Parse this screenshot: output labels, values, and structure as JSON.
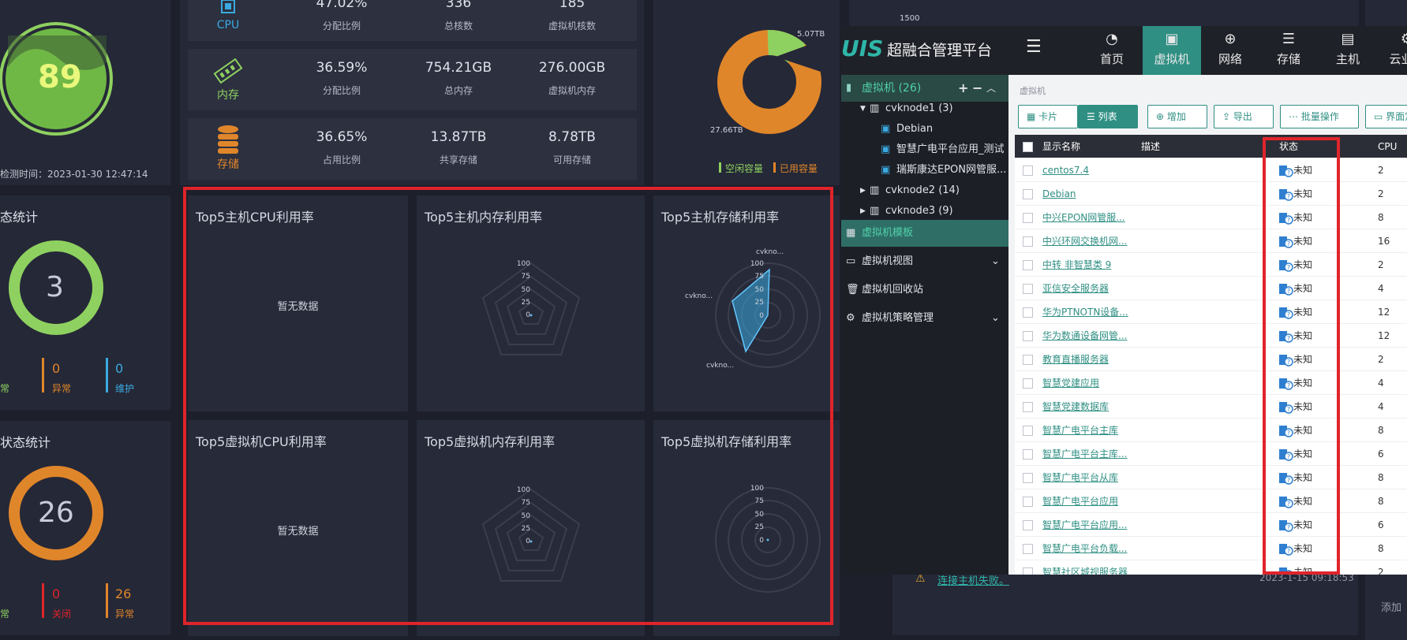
{
  "left": {
    "gauge_value": "89",
    "check_time": "检测时间：2023-01-30 12:47:14",
    "host_status": {
      "title": "态统计",
      "total": "3",
      "normal_label": "常",
      "abnormal_value": "0",
      "abnormal_label": "异常",
      "maint_value": "0",
      "maint_label": "维护"
    },
    "vm_status": {
      "title": "状态统计",
      "total": "26",
      "normal_label": "常",
      "off_value": "0",
      "off_label": "关闭",
      "abn_value": "26",
      "abn_label": "异常"
    }
  },
  "kpi": {
    "cpu": {
      "label": "CPU",
      "v1": "47.02%",
      "l1": "分配比例",
      "v2": "336",
      "l2": "总核数",
      "v3": "185",
      "l3": "虚拟机核数"
    },
    "mem": {
      "label": "内存",
      "v1": "36.59%",
      "l1": "分配比例",
      "v2": "754.21GB",
      "l2": "总内存",
      "v3": "276.00GB",
      "l3": "虚拟机内存"
    },
    "storage": {
      "label": "存储",
      "v1": "36.65%",
      "l1": "占用比例",
      "v2": "13.87TB",
      "l2": "共享存储",
      "v3": "8.78TB",
      "l3": "可用存储"
    }
  },
  "donut": {
    "top_label": "5.07TB",
    "left_label": "27.66TB",
    "legend_free": "空闲容量",
    "legend_used": "已用容量",
    "color_free": "#7cc35a",
    "color_used": "#e0862a"
  },
  "cards": {
    "host_cpu": "Top5主机CPU利用率",
    "host_mem": "Top5主机内存利用率",
    "host_storage": "Top5主机存储利用率",
    "vm_cpu": "Top5虚拟机CPU利用率",
    "vm_mem": "Top5虚拟机内存利用率",
    "vm_storage": "Top5虚拟机存储利用率",
    "no_data": "暂无数据",
    "radar_ticks": [
      "100",
      "75",
      "50",
      "25",
      "0"
    ],
    "radar_labels": [
      "cvkno...",
      "cvkno...",
      "cvkno..."
    ]
  },
  "right_bg": {
    "axis_top": "1500",
    "alert_text": "连接主机失败。",
    "alert_time": "2023-1-15 09:18:53",
    "add_label": "添加"
  },
  "app": {
    "logo": "UIS",
    "title": "超融合管理平台",
    "nav": [
      "首页",
      "虚拟机",
      "网络",
      "存储",
      "主机",
      "云业务"
    ],
    "sidebar": {
      "vm_group": "虚拟机 (26)",
      "node1": "cvknode1 (3)",
      "vm1": "Debian",
      "vm2": "智慧广电平台应用_测试",
      "vm3": "瑞斯康达EPON网管服...",
      "node2": "cvknode2 (14)",
      "node3": "cvknode3 (9)",
      "template": "虚拟机模板",
      "view": "虚拟机视图",
      "recycle": "虚拟机回收站",
      "policy": "虚拟机策略管理"
    },
    "breadcrumb": "虚拟机",
    "toolbar": {
      "card": "卡片",
      "list": "列表",
      "add": "增加",
      "export": "导出",
      "batch": "批量操作",
      "ui": "界面定"
    },
    "table": {
      "headers": {
        "name": "显示名称",
        "desc": "描述",
        "status": "状态",
        "cpu": "CPU"
      },
      "rows": [
        {
          "name": "centos7.4",
          "status": "未知",
          "cpu": "2"
        },
        {
          "name": "Debian",
          "status": "未知",
          "cpu": "2"
        },
        {
          "name": "中兴EPON网管服...",
          "status": "未知",
          "cpu": "8"
        },
        {
          "name": "中兴环网交换机网...",
          "status": "未知",
          "cpu": "16"
        },
        {
          "name": "中转 非智慧类 9",
          "status": "未知",
          "cpu": "2"
        },
        {
          "name": "亚信安全服务器",
          "status": "未知",
          "cpu": "4"
        },
        {
          "name": "华为PTNOTN设备...",
          "status": "未知",
          "cpu": "12"
        },
        {
          "name": "华为数通设备网管...",
          "status": "未知",
          "cpu": "12"
        },
        {
          "name": "教育直播服务器",
          "status": "未知",
          "cpu": "2"
        },
        {
          "name": "智慧党建应用",
          "status": "未知",
          "cpu": "4"
        },
        {
          "name": "智慧党建数据库",
          "status": "未知",
          "cpu": "4"
        },
        {
          "name": "智慧广电平台主库",
          "status": "未知",
          "cpu": "8"
        },
        {
          "name": "智慧广电平台主库...",
          "status": "未知",
          "cpu": "6"
        },
        {
          "name": "智慧广电平台从库",
          "status": "未知",
          "cpu": "8"
        },
        {
          "name": "智慧广电平台应用",
          "status": "未知",
          "cpu": "8"
        },
        {
          "name": "智慧广电平台应用...",
          "status": "未知",
          "cpu": "6"
        },
        {
          "name": "智慧广电平台负载...",
          "status": "未知",
          "cpu": "8"
        },
        {
          "name": "智慧社区城视服务器",
          "status": "未知",
          "cpu": "2"
        }
      ]
    }
  }
}
